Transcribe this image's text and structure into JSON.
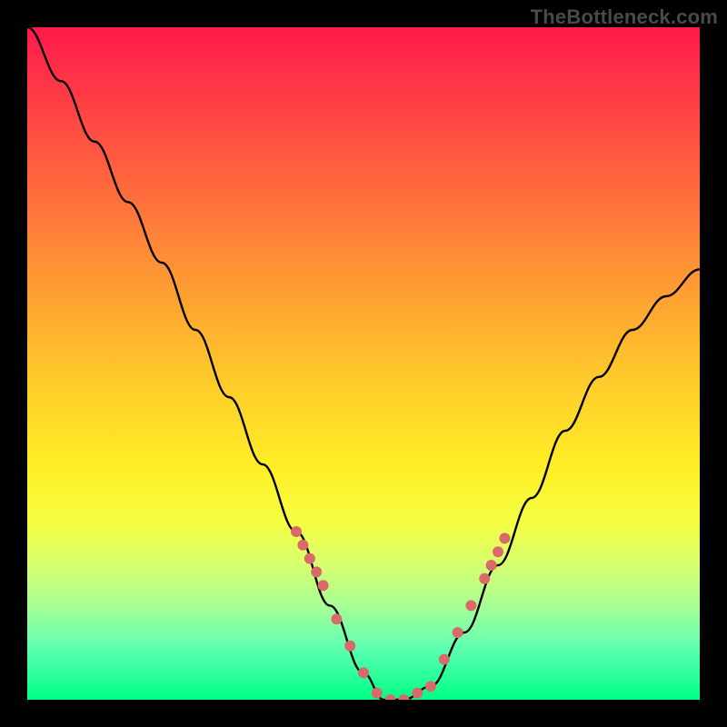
{
  "watermark": "TheBottleneck.com",
  "chart_data": {
    "type": "line",
    "title": "",
    "xlabel": "",
    "ylabel": "",
    "xlim": [
      0,
      100
    ],
    "ylim": [
      0,
      100
    ],
    "series": [
      {
        "name": "bottleneck-curve",
        "x": [
          0,
          5,
          10,
          15,
          20,
          25,
          30,
          35,
          40,
          45,
          50,
          53,
          56,
          60,
          65,
          70,
          75,
          80,
          85,
          90,
          95,
          100
        ],
        "values": [
          100,
          92,
          83,
          74,
          65,
          55,
          45,
          35,
          25,
          14,
          4,
          0,
          0,
          2,
          10,
          20,
          30,
          40,
          48,
          55,
          60,
          64
        ]
      }
    ],
    "markers": {
      "name": "highlight-dots",
      "x": [
        40,
        41,
        42,
        43,
        44,
        46,
        48,
        50,
        52,
        54,
        56,
        58,
        60,
        62,
        64,
        66,
        68,
        69,
        70,
        71
      ],
      "values": [
        25,
        23,
        21,
        19,
        17,
        12,
        8,
        4,
        1,
        0,
        0,
        1,
        2,
        6,
        10,
        14,
        18,
        20,
        22,
        24
      ]
    },
    "colors": {
      "background_top": "#ff1a4b",
      "background_bottom": "#00ff88",
      "curve": "#000000",
      "markers": "#d96a6a",
      "frame": "#000000"
    }
  }
}
